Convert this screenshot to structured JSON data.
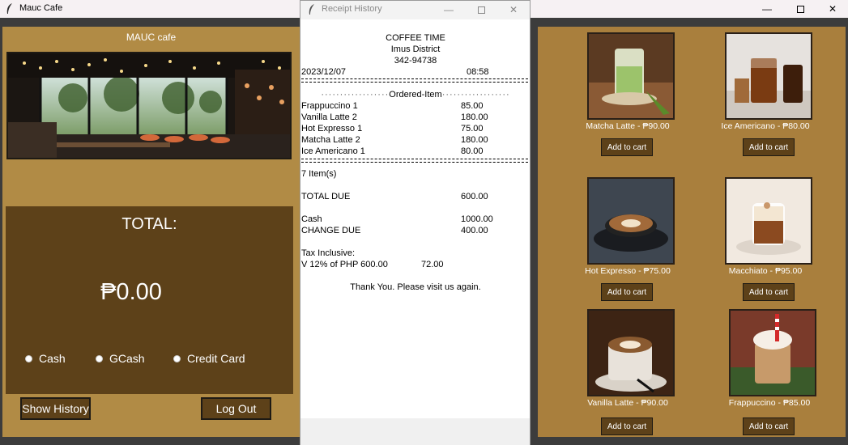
{
  "main_window": {
    "title": "Mauc Cafe"
  },
  "left": {
    "cafe_name": "MAUC cafe",
    "total_label": "TOTAL:",
    "total_value": "₱0.00",
    "payment_options": [
      "Cash",
      "GCash",
      "Credit Card"
    ],
    "show_history": "Show History",
    "logout": "Log Out"
  },
  "receipt": {
    "window_title": "Receipt History",
    "store": "COFFEE TIME",
    "district": "Imus District",
    "phone": "342-94738",
    "date": "2023/12/07",
    "time": "08:58",
    "ordered_item_label": "Ordered-Item",
    "items": [
      {
        "name": "Frappuccino 1",
        "price": "85.00"
      },
      {
        "name": "Vanilla Latte 2",
        "price": "180.00"
      },
      {
        "name": "Hot Expresso 1",
        "price": "75.00"
      },
      {
        "name": "Matcha Latte 2",
        "price": "180.00"
      },
      {
        "name": "Ice Americano 1",
        "price": "80.00"
      }
    ],
    "item_count": "7 Item(s)",
    "total_due_label": "TOTAL DUE",
    "total_due": "600.00",
    "cash_label": "Cash",
    "cash": "1000.00",
    "change_label": "CHANGE DUE",
    "change": "400.00",
    "tax_label": "Tax Inclusive:",
    "vat_line": "V 12% of PHP 600.00",
    "vat_value": "72.00",
    "thanks": "Thank You. Please visit us again."
  },
  "products": [
    {
      "label": "Matcha Latte - ₱90.00",
      "button": "Add to cart",
      "icon": "matcha-latte-photo"
    },
    {
      "label": "Ice Americano - ₱80.00",
      "button": "Add to cart",
      "icon": "ice-americano-photo"
    },
    {
      "label": "Hot Expresso - ₱75.00",
      "button": "Add to cart",
      "icon": "hot-expresso-photo"
    },
    {
      "label": "Macchiato - ₱95.00",
      "button": "Add to cart",
      "icon": "macchiato-photo"
    },
    {
      "label": "Vanilla Latte - ₱90.00",
      "button": "Add to cart",
      "icon": "vanilla-latte-photo"
    },
    {
      "label": "Frappuccino - ₱85.00",
      "button": "Add to cart",
      "icon": "frappuccino-photo"
    }
  ],
  "colors": {
    "panel_left": "#b18b45",
    "panel_right": "#a97f3d",
    "dark_brown": "#5d4119"
  }
}
